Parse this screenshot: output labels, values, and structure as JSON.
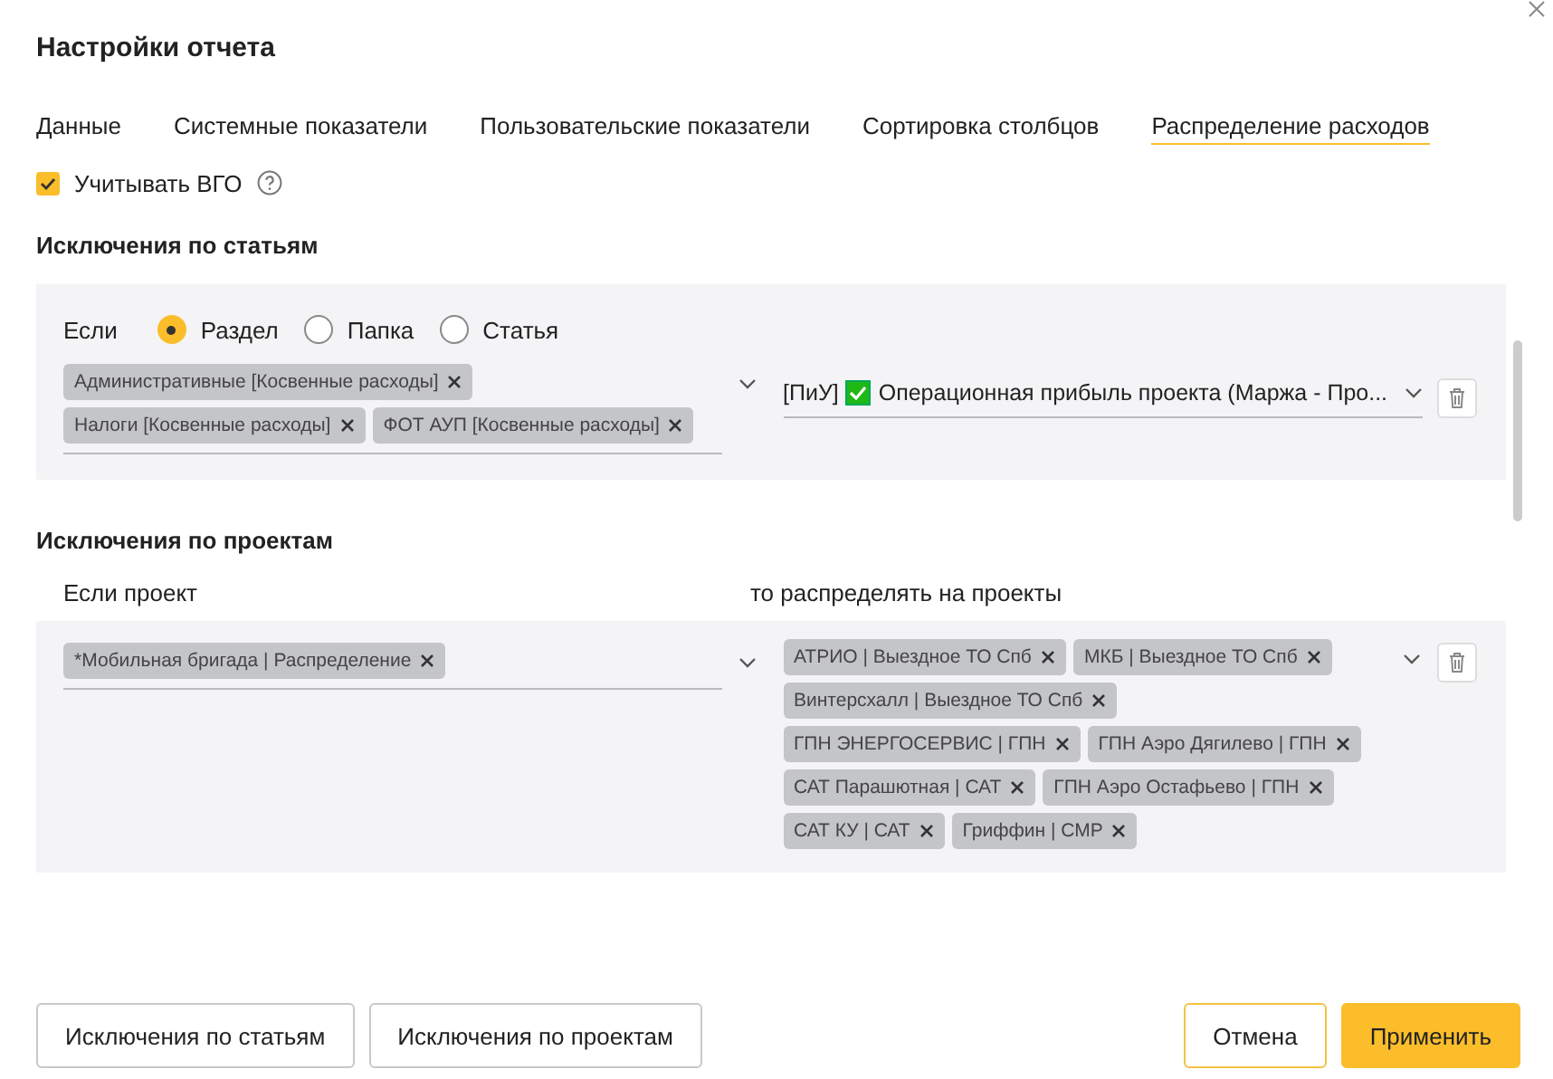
{
  "dialog": {
    "title": "Настройки отчета"
  },
  "tabs": [
    {
      "label": "Данные",
      "selected": false
    },
    {
      "label": "Системные показатели",
      "selected": false
    },
    {
      "label": "Пользовательские показатели",
      "selected": false
    },
    {
      "label": "Сортировка столбцов",
      "selected": false
    },
    {
      "label": "Распределение расходов",
      "selected": true
    }
  ],
  "vgo_checkbox": {
    "label": "Учитывать ВГО",
    "checked": true
  },
  "article_exceptions": {
    "heading": "Исключения по статьям",
    "condition_label": "Если",
    "radios": [
      {
        "label": "Раздел",
        "selected": true
      },
      {
        "label": "Папка",
        "selected": false
      },
      {
        "label": "Статья",
        "selected": false
      }
    ],
    "tags": [
      "Административные [Косвенные расходы]",
      "Налоги [Косвенные расходы]",
      "ФОТ АУП [Косвенные расходы]"
    ],
    "target": {
      "prefix": "[ПиУ]",
      "value": "Операционная прибыль проекта (Маржа - Про..."
    }
  },
  "project_exceptions": {
    "heading": "Исключения по проектам",
    "source_label": "Если проект",
    "target_label": "то распределять на проекты",
    "source_tags": [
      "*Мобильная бригада | Распределение"
    ],
    "target_tags": [
      "АТРИО | Выездное ТО Спб",
      "МКБ | Выездное ТО Спб",
      "Винтерсхалл | Выездное ТО Спб",
      "ГПН ЭНЕРГОСЕРВИС | ГПН",
      "ГПН Аэро Дягилево | ГПН",
      "САТ Парашютная | САТ",
      "ГПН Аэро Остафьево | ГПН",
      "САТ КУ | САТ",
      "Гриффин | СМР"
    ]
  },
  "footer_left_buttons": [
    {
      "label": "Исключения по статьям",
      "kind": "secondary"
    },
    {
      "label": "Исключения по проектам",
      "kind": "secondary"
    }
  ],
  "footer_right_buttons": [
    {
      "label": "Отмена",
      "kind": "outline"
    },
    {
      "label": "Применить",
      "kind": "primary"
    }
  ]
}
